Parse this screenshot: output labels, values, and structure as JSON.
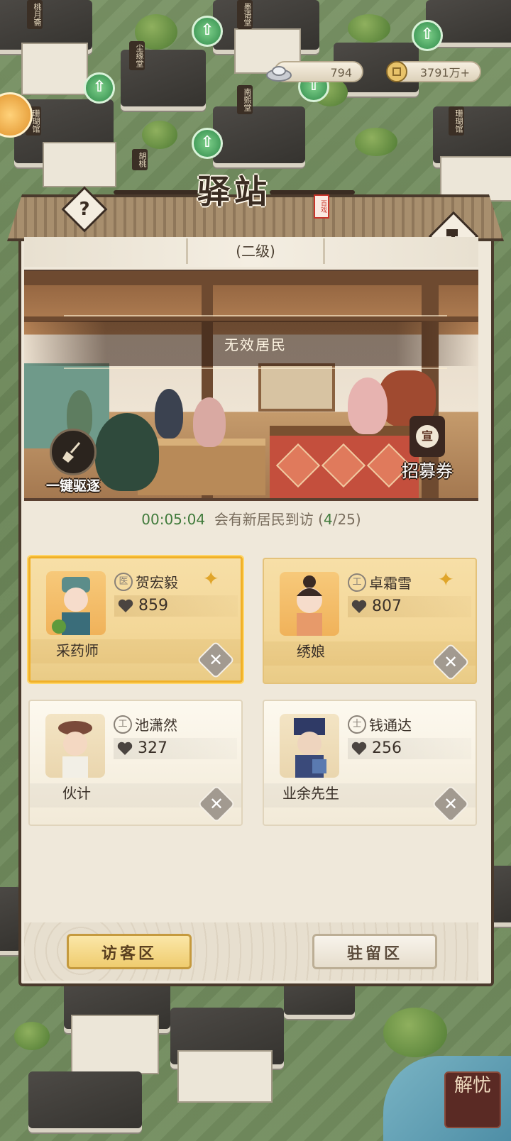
{
  "hud": {
    "silver": "794",
    "coins": "3791万+"
  },
  "city_signs": [
    "桃月斋",
    "墨语堂",
    "尘缘堂",
    "珊瑚馆",
    "南熙堂",
    "珊瑚馆",
    "胡桃"
  ],
  "panel": {
    "title": "驿站",
    "seal": "百戏",
    "help_icon": "?",
    "level": "(二级)",
    "scene_banner": "无效居民",
    "evict_label": "一键驱逐",
    "ticket_glyph": "宣",
    "ticket_label": "招募券"
  },
  "timer": {
    "countdown": "00:05:04",
    "message": "会有新居民到访 (",
    "current": "4",
    "total": "/25)"
  },
  "residents": [
    {
      "name": "贺宏毅",
      "badge": "医",
      "value": "859",
      "job": "采药师",
      "rarity": "gold",
      "selected": true
    },
    {
      "name": "卓霜雪",
      "badge": "工",
      "value": "807",
      "job": "绣娘",
      "rarity": "gold",
      "selected": false
    },
    {
      "name": "池潇然",
      "badge": "工",
      "value": "327",
      "job": "伙计",
      "rarity": "normal",
      "selected": false
    },
    {
      "name": "钱通达",
      "badge": "士",
      "value": "256",
      "job": "业余先生",
      "rarity": "normal",
      "selected": false
    }
  ],
  "tabs": {
    "visitor": "访客区",
    "resident": "驻留区"
  },
  "corner_logo": "解忧",
  "colors": {
    "frame": "#4a3a2c",
    "timer_green": "#3f7a3a",
    "gold_card": "#f3d798",
    "selected_border": "#f0b028"
  }
}
